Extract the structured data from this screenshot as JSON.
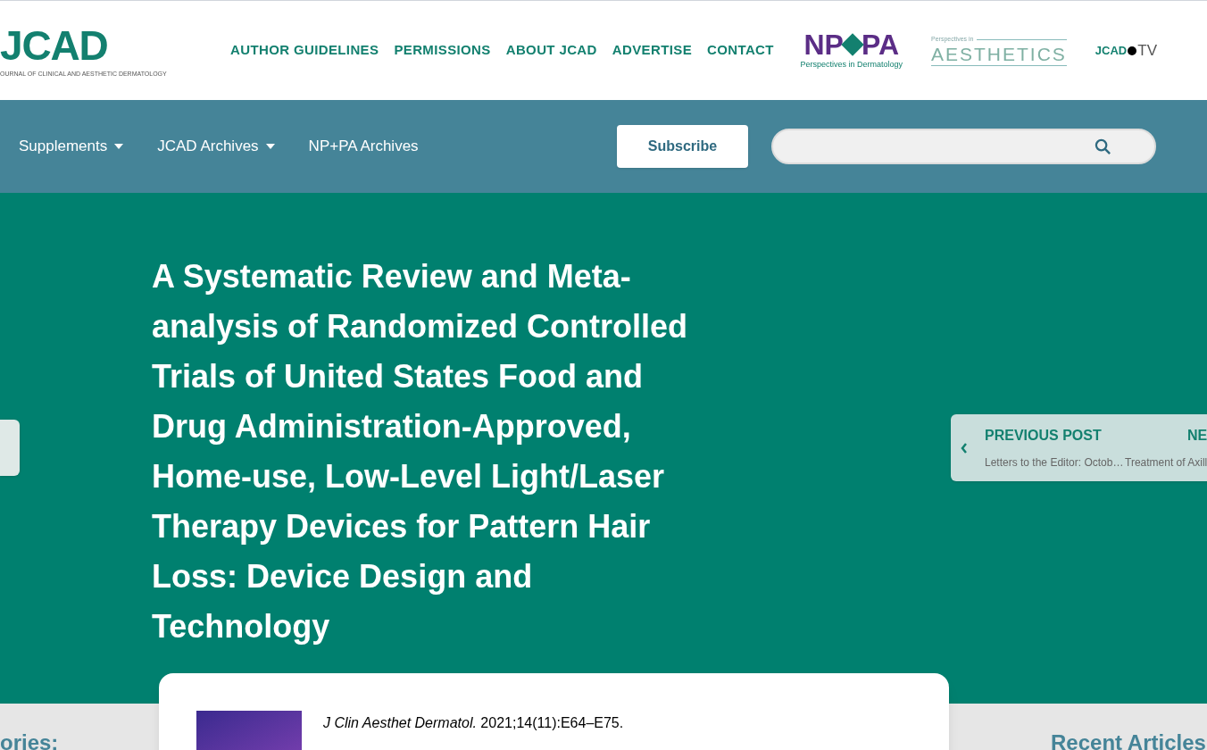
{
  "header": {
    "logo": "JCAD",
    "logo_subtitle": "OURNAL OF CLINICAL AND AESTHETIC DERMATOLOGY",
    "nav": [
      "AUTHOR GUIDELINES",
      "PERMISSIONS",
      "ABOUT JCAD",
      "ADVERTISE",
      "CONTACT"
    ],
    "partners": [
      {
        "kind": "nppa",
        "left": "NP",
        "right": "PA",
        "caption": "Perspectives in Dermatology"
      },
      {
        "kind": "aesthetics",
        "small": "Perspectives in",
        "big": "AESTHETICS"
      },
      {
        "kind": "tv",
        "left": "JCAD",
        "right": "TV"
      }
    ]
  },
  "menu": {
    "items": [
      {
        "label": "Supplements",
        "dropdown": true
      },
      {
        "label": "JCAD Archives",
        "dropdown": true
      },
      {
        "label": "NP+PA Archives",
        "dropdown": false
      }
    ],
    "subscribe": "Subscribe"
  },
  "article": {
    "title": "A Systematic Review and Meta-analysis of Randomized Controlled Trials of United States Food and Drug Administration-Approved, Home-use, Low-Level Light/Laser Therapy Devices for Pattern Hair Loss: Device Design and Technology",
    "post_nav": {
      "previous_label": "PREVIOUS POST",
      "previous_title": "Letters to the Editor: Octob…",
      "next_label": "NE",
      "next_title": "Treatment of Axill"
    },
    "citation": "*J Clin Aesthet Dermatol.* 2021;14(11):E64–E75."
  },
  "sidebar_left": {
    "heading": "ories:"
  },
  "sidebar_right": {
    "heading": "Recent Articles"
  }
}
